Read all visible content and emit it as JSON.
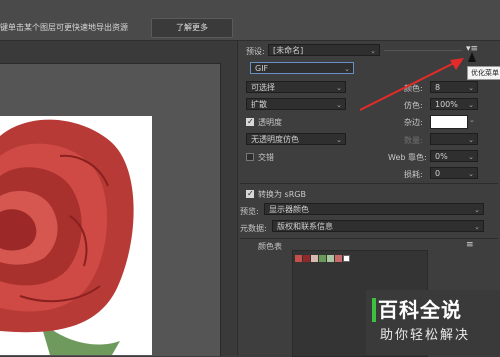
{
  "topbar": {
    "hint": "键单击某个图层可更快速地导出资源",
    "learn_more": "了解更多"
  },
  "settings": {
    "preset_label": "预设:",
    "preset_value": "[未命名]",
    "format_value": "GIF",
    "reduction_value": "可选择",
    "dither_value": "扩散",
    "colors_label": "颜色:",
    "colors_value": "8",
    "dither_pct_label": "仿色:",
    "dither_pct_value": "100%",
    "transparency_label": "透明度",
    "matte_label": "杂边:",
    "trans_dither_value": "无透明度仿色",
    "amount_label": "数量:",
    "interlaced_label": "交错",
    "websnap_label": "Web 靠色:",
    "websnap_value": "0%",
    "lossy_label": "损耗:",
    "lossy_value": "0",
    "convert_srgb_label": "转换为 sRGB",
    "preview_label": "预览:",
    "preview_value": "显示器颜色",
    "metadata_label": "元数据:",
    "metadata_value": "版权和联系信息",
    "color_table_label": "颜色表"
  },
  "tooltip": "优化菜单",
  "color_table": {
    "swatches": [
      "#c4504c",
      "#8e2a2a",
      "#d8b9b2",
      "#6a9a5a",
      "#a8c7a0",
      "#c86b68",
      "#ffffff"
    ]
  },
  "watermark": {
    "title": "百科全说",
    "subtitle": "助你轻松解决"
  }
}
